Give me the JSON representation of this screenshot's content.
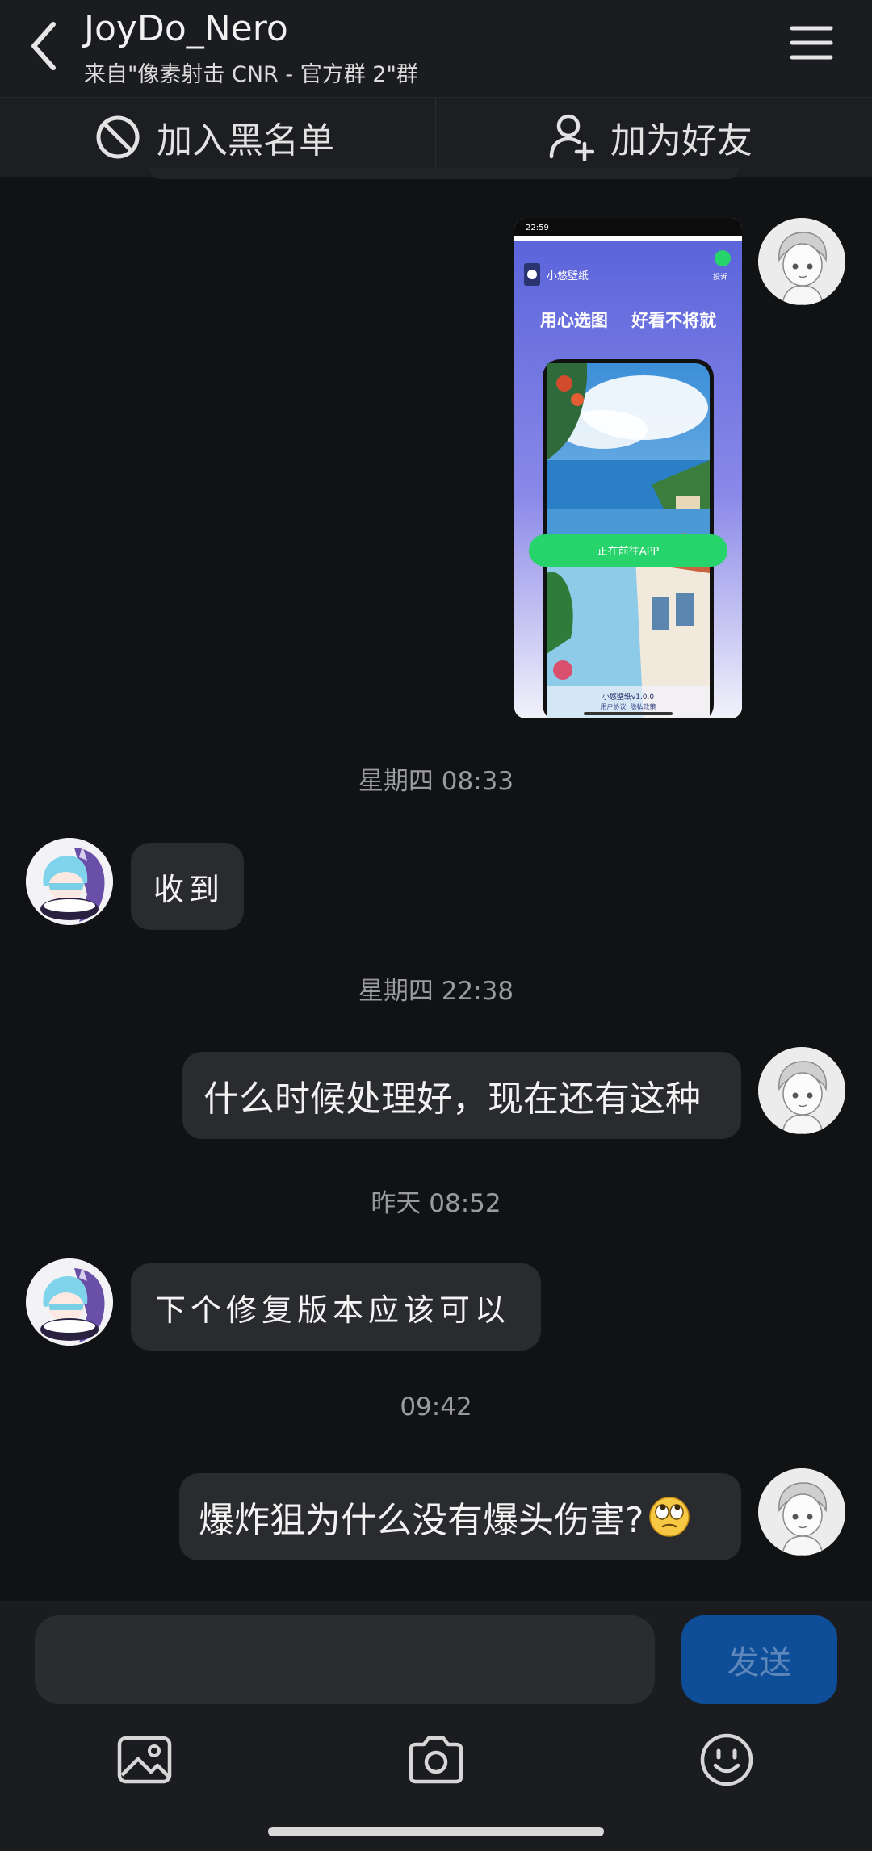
{
  "header": {
    "title": "JoyDo_Nero",
    "subtitle": "来自\"像素射击 CNR - 官方群 2\"群"
  },
  "actions": {
    "block_label": "加入黑名单",
    "add_friend_label": "加为好友"
  },
  "shared_image": {
    "status_time": "22:59",
    "app_name": "小悠壁纸",
    "report_label": "投诉",
    "slogan": "用心选图    好看不将就",
    "button_label": "正在前往APP",
    "version": "小悠壁纸v1.0.0",
    "footer_links": "用户协议  隐私政策"
  },
  "messages": [
    {
      "time": "星期四 08:33"
    },
    {
      "from": "other",
      "text": "收到"
    },
    {
      "time": "星期四 22:38"
    },
    {
      "from": "me",
      "text": "什么时候处理好，现在还有这种"
    },
    {
      "time": "昨天 08:52"
    },
    {
      "from": "other",
      "text": "下个修复版本应该可以"
    },
    {
      "time": "09:42"
    },
    {
      "from": "me",
      "text": "爆炸狙为什么没有爆头伤害?"
    }
  ],
  "composer": {
    "input_value": "",
    "send_label": "发送"
  },
  "icons": {
    "back": "back-chevron-icon",
    "menu": "hamburger-menu-icon",
    "block": "block-icon",
    "add_friend": "add-user-icon",
    "gallery": "image-icon",
    "camera": "camera-icon",
    "emoji": "smile-icon",
    "emoji_in_message": "eye-roll-emoji"
  },
  "colors": {
    "background": "#111214",
    "bubble": "#2a2b2e",
    "send_button": "#0e4e99",
    "app_button": "#27d36b"
  }
}
